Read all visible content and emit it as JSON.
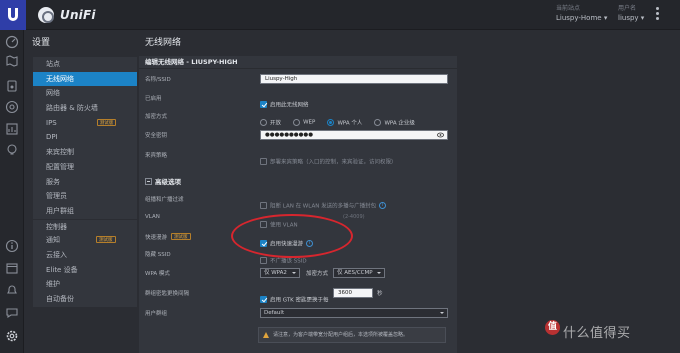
{
  "topbar": {
    "brand": "UniFi",
    "site_label": "当前站点",
    "site_value": "Liuspy-Home",
    "user_label": "用户名",
    "user_value": "liuspy"
  },
  "nav": {
    "title": "设置",
    "items": [
      {
        "label": "站点"
      },
      {
        "label": "无线网络"
      },
      {
        "label": "网络"
      },
      {
        "label": "路由器 & 防火墙"
      },
      {
        "label": "IPS",
        "badge": "测试版"
      },
      {
        "label": "DPI"
      },
      {
        "label": "来宾控制"
      },
      {
        "label": "配置管理"
      },
      {
        "label": "服务"
      },
      {
        "label": "管理员"
      },
      {
        "label": "用户群组"
      },
      {
        "label": "控制器"
      },
      {
        "label": "通知",
        "badge": "测试版"
      },
      {
        "label": "云接入"
      },
      {
        "label": "Elite 设备"
      },
      {
        "label": "维护"
      },
      {
        "label": "自动备份"
      }
    ],
    "active_index": 1
  },
  "main": {
    "page_title": "无线网络",
    "panel_header": "编辑无线网络 - LIUSPY-HIGH",
    "name_label": "名称/SSID",
    "name_value": "Liuspy-High",
    "enabled_label": "已启用",
    "enabled_text": "启用此无线网络",
    "security_label": "加密方式",
    "security_options": [
      "开放",
      "WEP",
      "WPA 个人",
      "WPA 企业级"
    ],
    "security_selected": "WPA 个人",
    "key_label": "安全密钥",
    "key_value": "●●●●●●●●●●",
    "guest_label": "来宾策略",
    "guest_text": "部署来宾策略（入口的控制，来宾验证，访问权限）",
    "advanced_title": "高级选项",
    "broadcast_label": "组播和广播过滤",
    "broadcast_text": "阻断 LAN 在 WLAN 发送的多播与广播封包",
    "vlan_label": "VLAN",
    "vlan_text": "使用 VLAN",
    "vlan_hint": "(2-4009)",
    "fast_label": "快速漫游",
    "fast_badge": "测试版",
    "fast_text": "启用快速漫游",
    "hide_label": "隐藏 SSID",
    "hide_text": "不广播该 SSID",
    "wpa_label": "WPA 模式",
    "wpa_value": "仅 WPA2",
    "encrypt_label": "加密方式",
    "encrypt_value": "仅 AES/CCMP",
    "gtk_label": "群组密匙更换间隔",
    "gtk_text": "启用 GTK 密匙更换于每",
    "gtk_value": "3600",
    "gtk_unit": "秒",
    "usergroup_label": "用户群组",
    "usergroup_value": "Default",
    "notice": "请注意，为客户端带宽分配用户组后，本选项所被覆盖忽略。"
  },
  "watermark": "值 什么值得买",
  "colors": {
    "accent": "#1c83c6",
    "annotation": "#d7262e",
    "beta": "#e0a43c"
  }
}
